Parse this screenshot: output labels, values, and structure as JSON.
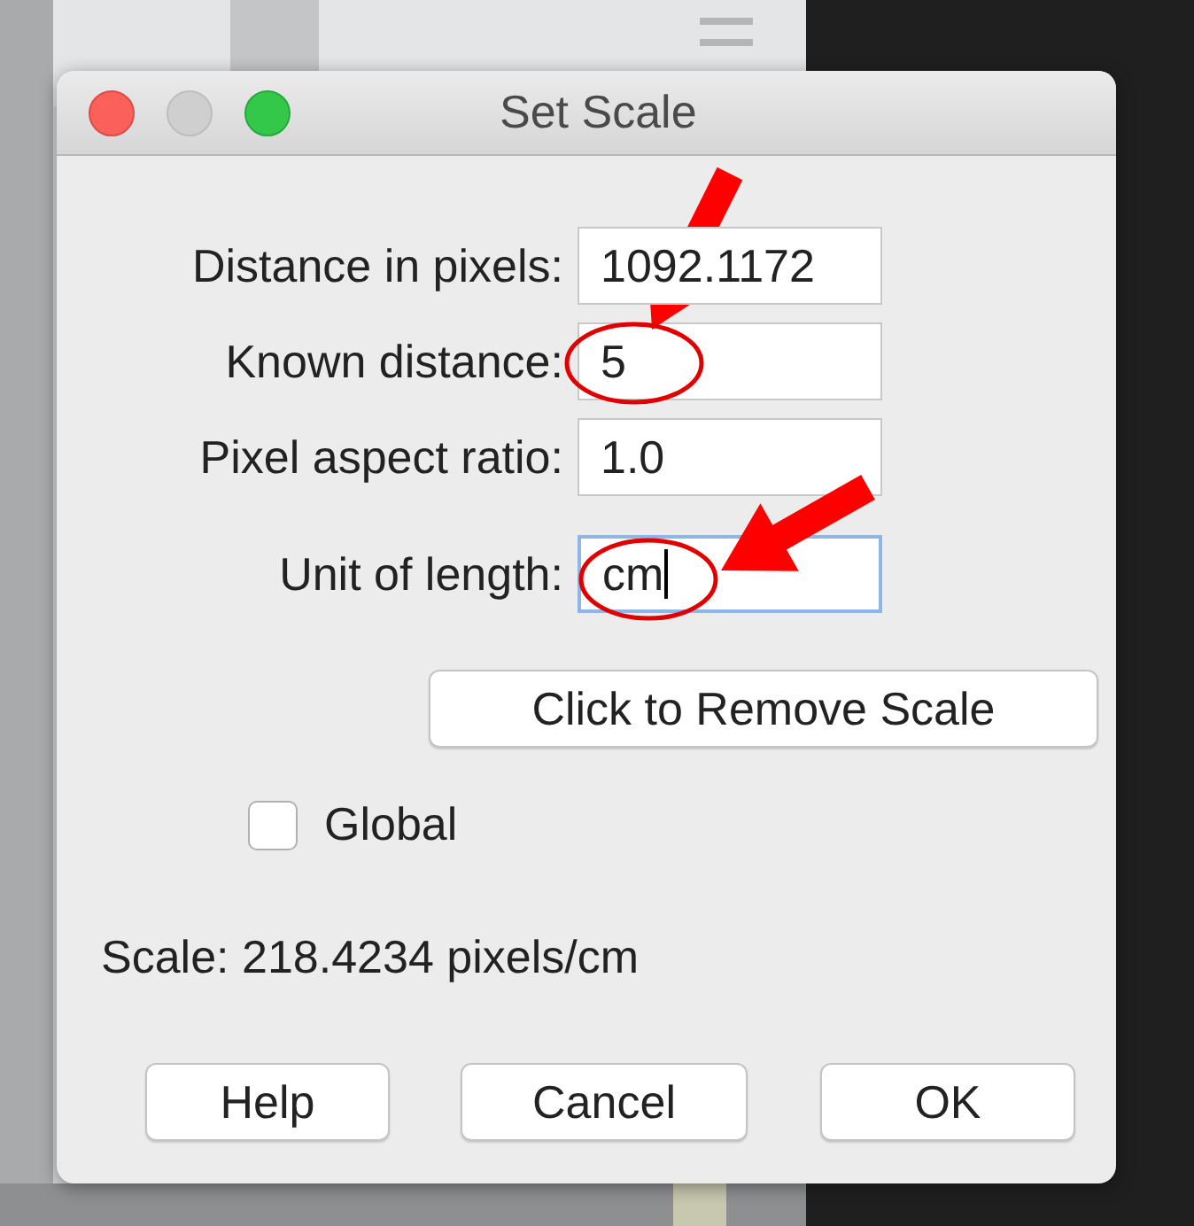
{
  "window": {
    "title": "Set Scale"
  },
  "fields": [
    {
      "label": "Distance in pixels:",
      "value": "1092.1172",
      "focused": false
    },
    {
      "label": "Known distance:",
      "value": "5",
      "focused": false
    },
    {
      "label": "Pixel aspect ratio:",
      "value": "1.0",
      "focused": false
    },
    {
      "label": "Unit of length:",
      "value": "cm",
      "focused": true
    }
  ],
  "remove_button": "Click to Remove Scale",
  "global": {
    "label": "Global",
    "checked": false
  },
  "scale_text": "Scale: 218.4234 pixels/cm",
  "buttons": [
    "Help",
    "Cancel",
    "OK"
  ]
}
